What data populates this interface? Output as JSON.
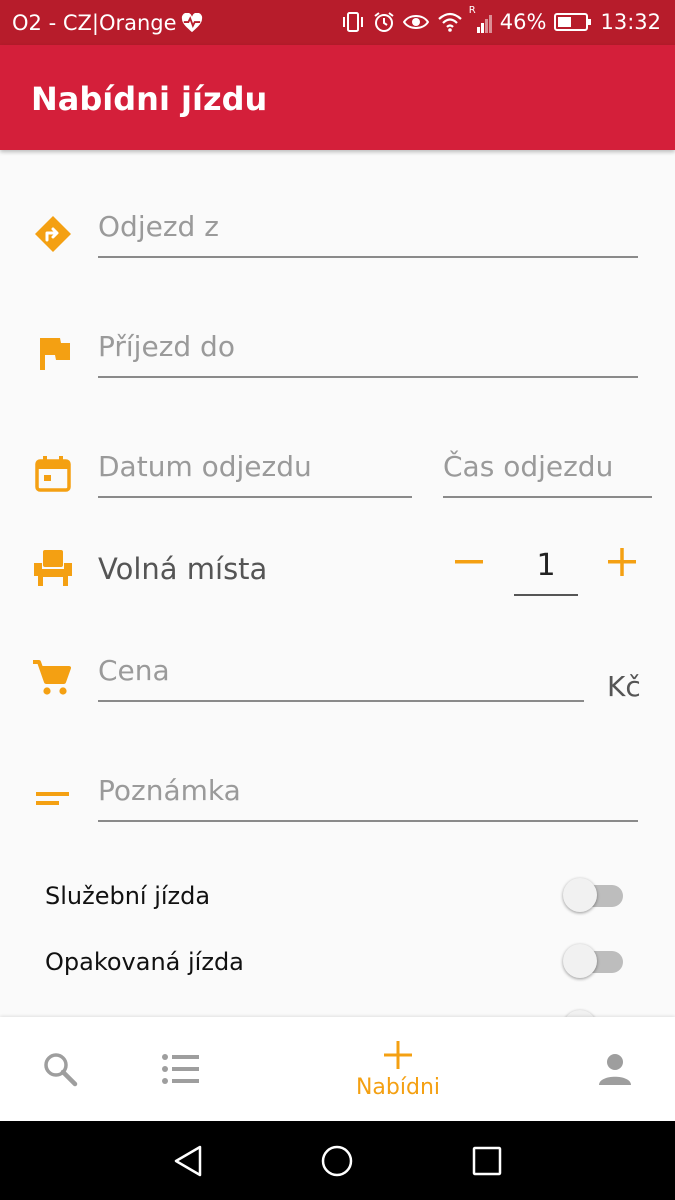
{
  "statusbar": {
    "carrier": "O2 - CZ|Orange",
    "battery": "46%",
    "time": "13:32",
    "roaming": "R"
  },
  "appbar": {
    "title": "Nabídni jízdu"
  },
  "form": {
    "from_placeholder": "Odjezd z",
    "to_placeholder": "Příjezd do",
    "date_placeholder": "Datum odjezdu",
    "time_placeholder": "Čas odjezdu",
    "seats_label": "Volná místa",
    "seats_value": "1",
    "price_placeholder": "Cena",
    "currency": "Kč",
    "note_placeholder": "Poznámka",
    "switches": [
      {
        "label": "Služební jízda",
        "on": false
      },
      {
        "label": "Opakovaná jízda",
        "on": false
      },
      {
        "label": "",
        "on": false
      }
    ]
  },
  "bottomnav": {
    "items": [
      {
        "icon": "search-icon",
        "label": ""
      },
      {
        "icon": "list-icon",
        "label": ""
      },
      {
        "icon": "plus-icon",
        "label": "Nabídni",
        "active": true
      },
      {
        "icon": "person-icon",
        "label": ""
      }
    ]
  },
  "colors": {
    "appbar": "#d41f3a",
    "statusbar": "#b71c2b",
    "accent": "#f4a012"
  }
}
